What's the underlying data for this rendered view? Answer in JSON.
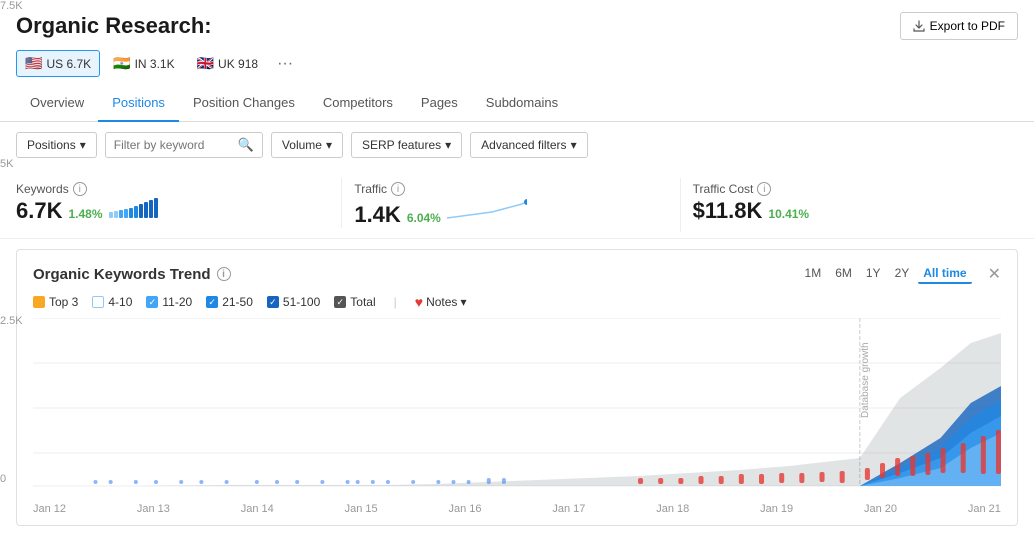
{
  "page": {
    "title": "Organic Research:",
    "export_btn": "Export to PDF"
  },
  "country_tabs": [
    {
      "id": "us",
      "flag": "🇺🇸",
      "label": "US",
      "value": "6.7K",
      "active": true
    },
    {
      "id": "in",
      "flag": "🇮🇳",
      "label": "IN",
      "value": "3.1K",
      "active": false
    },
    {
      "id": "uk",
      "flag": "🇬🇧",
      "label": "UK",
      "value": "918",
      "active": false
    }
  ],
  "nav_tabs": [
    {
      "label": "Overview",
      "active": false
    },
    {
      "label": "Positions",
      "active": true
    },
    {
      "label": "Position Changes",
      "active": false
    },
    {
      "label": "Competitors",
      "active": false
    },
    {
      "label": "Pages",
      "active": false
    },
    {
      "label": "Subdomains",
      "active": false
    }
  ],
  "filters": {
    "positions_label": "Positions",
    "keyword_placeholder": "Filter by keyword",
    "volume_label": "Volume",
    "serp_label": "SERP features",
    "advanced_label": "Advanced filters"
  },
  "metrics": [
    {
      "label": "Keywords",
      "value": "6.7K",
      "change": "1.48%",
      "has_sparkline": true
    },
    {
      "label": "Traffic",
      "value": "1.4K",
      "change": "6.04%",
      "has_sparkline": true
    },
    {
      "label": "Traffic Cost",
      "value": "$11.8K",
      "change": "10.41%",
      "has_sparkline": false
    }
  ],
  "chart": {
    "title": "Organic Keywords Trend",
    "legend": [
      {
        "label": "Top 3",
        "color": "#f9a825",
        "type": "dot"
      },
      {
        "label": "4-10",
        "color": "#90caf9",
        "type": "check",
        "checked": false
      },
      {
        "label": "11-20",
        "color": "#42a5f5",
        "type": "check",
        "checked": true
      },
      {
        "label": "21-50",
        "color": "#1e88e5",
        "type": "check",
        "checked": true
      },
      {
        "label": "51-100",
        "color": "#1565c0",
        "type": "check",
        "checked": true
      },
      {
        "label": "Total",
        "type": "check",
        "checked": true,
        "color": "#555"
      },
      {
        "label": "Notes",
        "type": "notes"
      }
    ],
    "time_ranges": [
      "1M",
      "6M",
      "1Y",
      "2Y",
      "All time"
    ],
    "active_time_range": "All time",
    "y_labels": [
      "7.5K",
      "5K",
      "2.5K",
      "0"
    ],
    "x_labels": [
      "Jan 12",
      "Jan 13",
      "Jan 14",
      "Jan 15",
      "Jan 16",
      "Jan 17",
      "Jan 18",
      "Jan 19",
      "Jan 20",
      "Jan 21"
    ]
  }
}
